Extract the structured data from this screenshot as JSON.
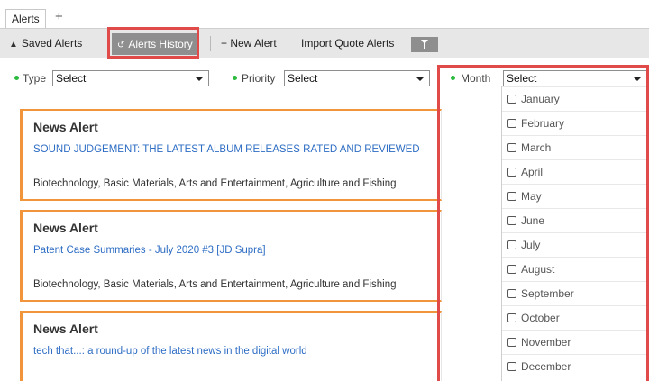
{
  "tabs": {
    "active_label": "Alerts",
    "add_label": "+"
  },
  "toolbar": {
    "saved_alerts": "Saved Alerts",
    "alerts_history": "Alerts History",
    "new_alert": "+ New Alert",
    "import_quote_alerts": "Import Quote Alerts"
  },
  "filters": {
    "type": {
      "label": "Type",
      "value": "Select"
    },
    "priority": {
      "label": "Priority",
      "value": "Select"
    },
    "month": {
      "label": "Month",
      "value": "Select",
      "options": [
        "January",
        "February",
        "March",
        "April",
        "May",
        "June",
        "July",
        "August",
        "September",
        "October",
        "November",
        "December"
      ]
    }
  },
  "alerts": [
    {
      "title": "News Alert",
      "headline": "SOUND JUDGEMENT: THE LATEST ALBUM RELEASES RATED AND REVIEWED",
      "tags": "Biotechnology, Basic Materials, Arts and Entertainment, Agriculture and Fishing"
    },
    {
      "title": "News Alert",
      "headline": "Patent Case Summaries - July 2020 #3 [JD Supra]",
      "tags": "Biotechnology, Basic Materials, Arts and Entertainment, Agriculture and Fishing"
    },
    {
      "title": "News Alert",
      "headline": "tech that...: a round-up of the latest news in the digital world",
      "tags": ""
    }
  ],
  "colors": {
    "accent_orange": "#f0953b",
    "highlight_red": "#e04a48",
    "link_blue": "#2e6dc4",
    "status_green": "#2cbb3f"
  }
}
